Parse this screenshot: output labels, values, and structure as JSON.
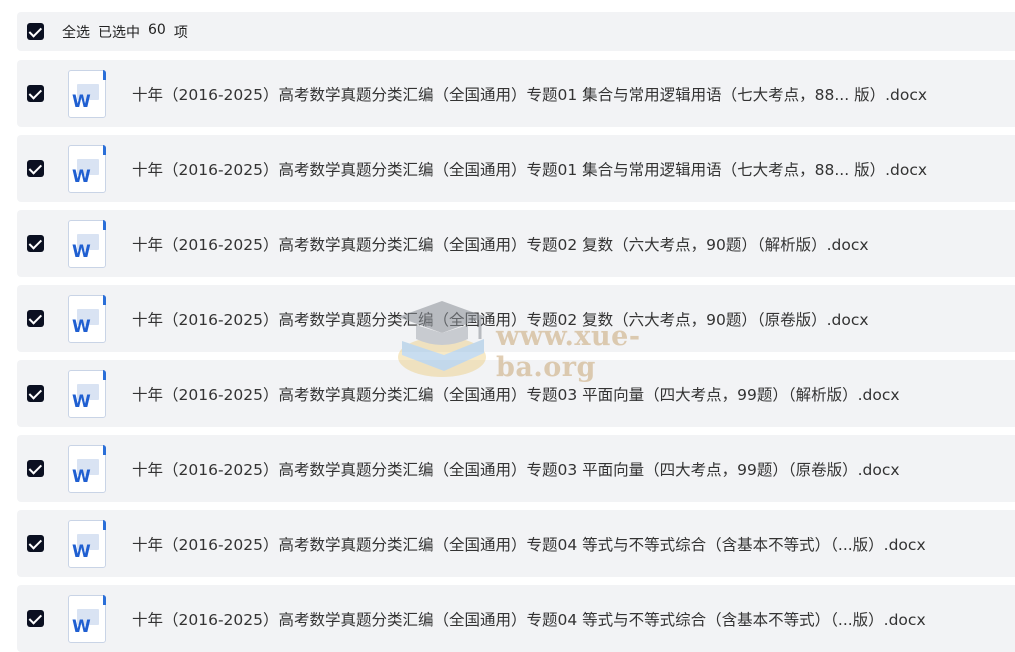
{
  "header": {
    "select_all_label": "全选",
    "selected_prefix": "已选中",
    "selected_count": "60",
    "selected_suffix": "项"
  },
  "watermark": {
    "text": "www.xue-ba.org"
  },
  "files": [
    {
      "name": "十年（2016-2025）高考数学真题分类汇编（全国通用）专题01 集合与常用逻辑用语（七大考点，88...   版）.docx",
      "checked": true,
      "icon": "word-doc-icon"
    },
    {
      "name": "十年（2016-2025）高考数学真题分类汇编（全国通用）专题01 集合与常用逻辑用语（七大考点，88...   版）.docx",
      "checked": true,
      "icon": "word-doc-icon"
    },
    {
      "name": "十年（2016-2025）高考数学真题分类汇编（全国通用）专题02 复数（六大考点，90题）（解析版）.docx",
      "checked": true,
      "icon": "word-doc-icon"
    },
    {
      "name": "十年（2016-2025）高考数学真题分类汇编（全国通用）专题02 复数（六大考点，90题）（原卷版）.docx",
      "checked": true,
      "icon": "word-doc-icon"
    },
    {
      "name": "十年（2016-2025）高考数学真题分类汇编（全国通用）专题03 平面向量（四大考点，99题）（解析版）.docx",
      "checked": true,
      "icon": "word-doc-icon"
    },
    {
      "name": "十年（2016-2025）高考数学真题分类汇编（全国通用）专题03 平面向量（四大考点，99题）（原卷版）.docx",
      "checked": true,
      "icon": "word-doc-icon"
    },
    {
      "name": "十年（2016-2025）高考数学真题分类汇编（全国通用）专题04 等式与不等式综合（含基本不等式）（...版）.docx",
      "checked": true,
      "icon": "word-doc-icon"
    },
    {
      "name": "十年（2016-2025）高考数学真题分类汇编（全国通用）专题04 等式与不等式综合（含基本不等式）（...版）.docx",
      "checked": true,
      "icon": "word-doc-icon"
    }
  ]
}
